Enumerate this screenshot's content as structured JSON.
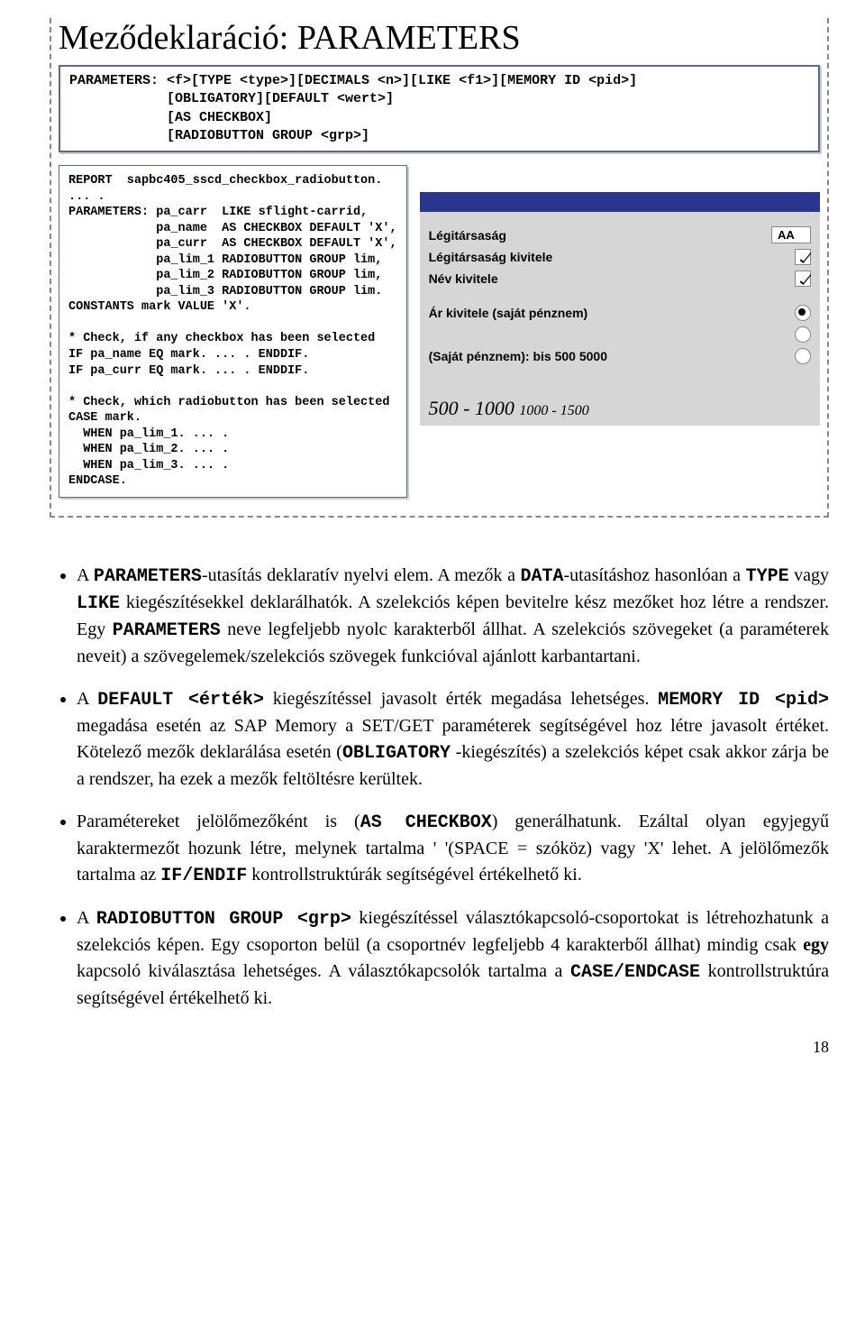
{
  "title": "Meződeklaráció: PARAMETERS",
  "syntax": "PARAMETERS: <f>[TYPE <type>][DECIMALS <n>][LIKE <f1>][MEMORY ID <pid>]\n            [OBLIGATORY][DEFAULT <wert>]\n            [AS CHECKBOX]\n            [RADIOBUTTON GROUP <grp>]",
  "code": "REPORT  sapbc405_sscd_checkbox_radiobutton.\n... .\nPARAMETERS: pa_carr  LIKE sflight-carrid,\n            pa_name  AS CHECKBOX DEFAULT 'X',\n            pa_curr  AS CHECKBOX DEFAULT 'X',\n            pa_lim_1 RADIOBUTTON GROUP lim,\n            pa_lim_2 RADIOBUTTON GROUP lim,\n            pa_lim_3 RADIOBUTTON GROUP lim.\nCONSTANTS mark VALUE 'X'.\n\n* Check, if any checkbox has been selected\nIF pa_name EQ mark. ... . ENDDIF.\nIF pa_curr EQ mark. ... . ENDDIF.\n\n* Check, which radiobutton has been selected\nCASE mark.\n  WHEN pa_lim_1. ... .\n  WHEN pa_lim_2. ... .\n  WHEN pa_lim_3. ... .\nENDCASE.",
  "sap": {
    "r1_label": "Légitársaság",
    "r1_value": "AA",
    "r2_label": "Légitársaság kivitele",
    "r3_label": "Név kivitele",
    "r4_label": "Ár kivitele (saját pénznem)",
    "r5_prefix": "(Saját pénznem): ",
    "r5_bis": "bis 500 5000",
    "foot_main": "500 - 1000 ",
    "foot_small": "1000 - 1500"
  },
  "bullets": {
    "b1_p1": "A ",
    "b1_c1": "PARAMETERS",
    "b1_p2": "-utasítás deklaratív nyelvi elem. A mezők a ",
    "b1_c2": "DATA",
    "b1_p3": "-utasításhoz hasonlóan a ",
    "b1_c3": "TYPE",
    "b1_p4": " vagy ",
    "b1_c4": "LIKE",
    "b1_p5": " kiegészítésekkel deklarálhatók. A szelekciós képen bevitelre kész mezőket hoz létre a rendszer. Egy ",
    "b1_c5": "PARAMETERS",
    "b1_p6": " neve legfeljebb nyolc karakterből állhat. A szelekciós szövegeket (a paraméterek neveit) a szövegelemek/szelekciós szövegek funkcióval ajánlott karbantartani.",
    "b2_p1": "A ",
    "b2_c1": "DEFAULT <érték>",
    "b2_p2": " kiegészítéssel javasolt érték megadása lehetséges. ",
    "b2_c2": "MEMORY ID <pid>",
    "b2_p3": " megadása esetén az SAP Memory a SET/GET paraméterek segítségével hoz létre javasolt értéket. Kötelező mezők deklarálása esetén (",
    "b2_c3": "OBLIGATORY",
    "b2_p4": " -kiegészítés) a szelekciós képet csak akkor zárja be a rendszer, ha ezek a mezők feltöltésre kerültek.",
    "b3_p1": "Paramétereket jelölőmezőként is (",
    "b3_c1": "AS CHECKBOX",
    "b3_p2": ") generálhatunk. Ezáltal olyan egyjegyű karaktermezőt hozunk létre, melynek tartalma '  '(SPACE = szóköz) vagy 'X' lehet. A jelölőmezők tartalma az ",
    "b3_c2": "IF/ENDIF",
    "b3_p3": " kontrollstruktúrák segítségével értékelhető ki.",
    "b4_p1": "A ",
    "b4_c1": "RADIOBUTTON GROUP <grp>",
    "b4_p2": " kiegészítéssel választókapcsoló-csoportokat is létrehozhatunk a szelekciós képen. Egy csoporton belül (a csoportnév legfeljebb 4 karakterből állhat) mindig csak ",
    "b4_s1": "egy",
    "b4_p3": " kapcsoló kiválasztása lehetséges. A választókapcsolók tartalma a ",
    "b4_c2": "CASE/ENDCASE",
    "b4_p4": " kontrollstruktúra segítségével értékelhető ki."
  },
  "page_number": "18"
}
